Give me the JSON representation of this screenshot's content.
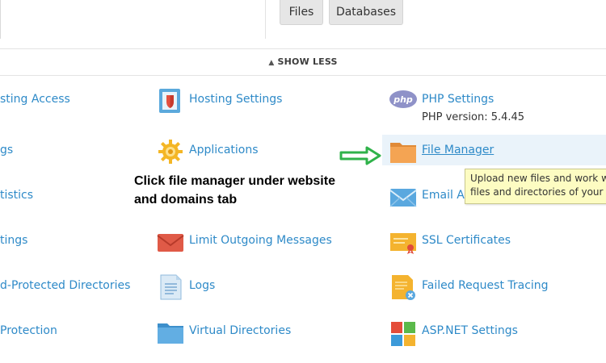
{
  "top_tabs": {
    "files": "Files",
    "databases": "Databases"
  },
  "show_less": {
    "label": "SHOW LESS",
    "icon": "chevron-up-icon"
  },
  "column1": [
    {
      "label": "sting Access"
    },
    {
      "label": "gs"
    },
    {
      "label": "tistics"
    },
    {
      "label": "tings"
    },
    {
      "label": "d-Protected Directories"
    },
    {
      "label": "Protection"
    }
  ],
  "column2": [
    {
      "label": "Hosting Settings",
      "icon": "hosting-settings-icon"
    },
    {
      "label": "Applications",
      "icon": "applications-gear-icon"
    },
    {
      "label": "Limit Outgoing Messages",
      "icon": "envelope-limit-icon"
    },
    {
      "label": "Logs",
      "icon": "logs-icon"
    },
    {
      "label": "Virtual Directories",
      "icon": "folder-icon"
    }
  ],
  "column3": [
    {
      "label": "PHP Settings",
      "sub": "PHP version: 5.4.45",
      "icon": "php-icon"
    },
    {
      "label": "File Manager",
      "icon": "folder-icon"
    },
    {
      "label": "Email Ac",
      "icon": "email-icon"
    },
    {
      "label": "SSL Certificates",
      "icon": "certificate-icon"
    },
    {
      "label": "Failed Request Tracing",
      "icon": "failed-request-icon"
    },
    {
      "label": "ASP.NET Settings",
      "icon": "aspnet-icon"
    }
  ],
  "tooltip": {
    "line1": "Upload new files and work w",
    "line2": "files and directories of your w"
  },
  "annotation": {
    "line1": "Click file manager under website",
    "line2": "and domains tab"
  },
  "colors": {
    "link": "#2e8ac8",
    "tooltip_bg": "#fdfcc2",
    "arrow": "#2fb24a",
    "highlight": "#eaf3fa"
  }
}
